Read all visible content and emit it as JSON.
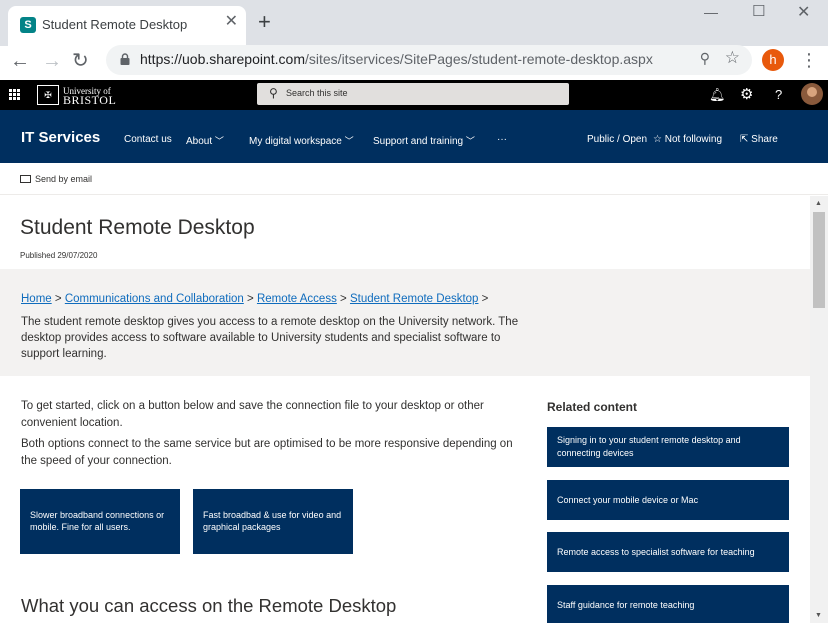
{
  "browser": {
    "tab_title": "Student Remote Desktop",
    "tab_favicon_letter": "S",
    "new_tab": "+",
    "url_host": "https://uob.sharepoint.com",
    "url_path": "/sites/itservices/SitePages/student-remote-desktop.aspx",
    "profile_initial": "h"
  },
  "suitebar": {
    "logo_line1": "University of",
    "logo_line2": "BRISTOL",
    "search_placeholder": "Search this site"
  },
  "hub": {
    "site_title": "IT Services",
    "nav": [
      "Contact us",
      "About",
      "My digital workspace",
      "Support and training",
      "···"
    ],
    "public_open": "Public / Open",
    "not_following": "Not following",
    "share": "Share"
  },
  "command_bar": {
    "send_by_email": "Send by email"
  },
  "page": {
    "title": "Student Remote Desktop",
    "published": "Published 29/07/2020",
    "breadcrumb": [
      "Home",
      "Communications and Collaboration",
      "Remote Access",
      "Student Remote Desktop"
    ],
    "breadcrumb_sep": ">",
    "intro": "The student remote desktop gives you access to a remote desktop on the University network. The desktop provides access to software available to University students and specialist software to support learning.",
    "para1": "To get started, click on a button below and save the connection file to your desktop or other convenient location.",
    "para2": "Both options connect to the same service but are optimised to be more responsive depending on the speed of your connection.",
    "button_slow": "Slower broadband connections or mobile. Fine for all users.",
    "button_fast": "Fast broadbad & use for video and graphical packages",
    "section_heading": "What you can access on the Remote Desktop"
  },
  "related": {
    "heading": "Related content",
    "items": [
      "Signing in to your student remote desktop and connecting devices",
      "Connect your mobile device or Mac",
      "Remote access to specialist software for teaching",
      "Staff guidance for remote teaching"
    ]
  }
}
